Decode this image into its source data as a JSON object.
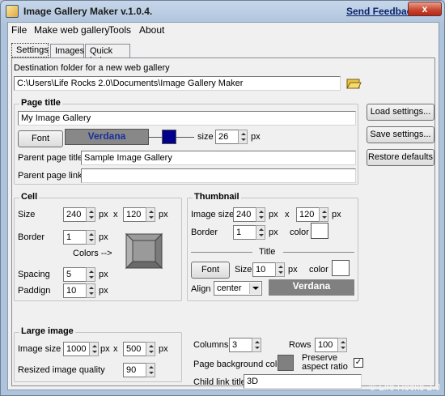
{
  "window": {
    "title": "Image Gallery Maker  v.1.0.4.",
    "feedback": "Send Feedback",
    "close_label": "x"
  },
  "menu": [
    "File",
    "Make web gallery",
    "Tools",
    "About"
  ],
  "tabs": [
    "Settings",
    "Images",
    "Quick help"
  ],
  "destination": {
    "label": "Destination folder for a new web gallery",
    "value": "C:\\Users\\Life Rocks 2.0\\Documents\\Image Gallery Maker"
  },
  "page_title": {
    "group": "Page title",
    "value": "My Image Gallery",
    "font_button": "Font",
    "font_preview": "Verdana",
    "color": "#00008b",
    "size_label": "size",
    "size_value": "26",
    "size_unit": "px",
    "parent_title_label": "Parent page title",
    "parent_title_value": "Sample Image Gallery",
    "parent_link_label": "Parent page link",
    "parent_link_value": ""
  },
  "side_buttons": {
    "load": "Load settings...",
    "save": "Save settings...",
    "restore": "Restore defaults"
  },
  "cell": {
    "group": "Cell",
    "size_label": "Size",
    "width": "240",
    "height": "120",
    "px": "px",
    "x": "x",
    "border_label": "Border",
    "border": "1",
    "colors_label": "Colors -->",
    "spacing_label": "Spacing",
    "spacing": "5",
    "padding_label": "Paddign",
    "padding": "10"
  },
  "thumbnail": {
    "group": "Thumbnail",
    "size_label": "Image size",
    "width": "240",
    "height": "120",
    "px": "px",
    "x": "x",
    "border_label": "Border",
    "border": "1",
    "color_label": "color",
    "title_label": "Title",
    "font_button": "Font",
    "size_label2": "Size",
    "size": "10",
    "color_label2": "color",
    "align_label": "Align",
    "align": "center",
    "font_preview": "Verdana"
  },
  "large_image": {
    "group": "Large image",
    "size_label": "Image size",
    "width": "1000",
    "height": "500",
    "px": "px",
    "x": "x",
    "quality_label": "Resized image quality",
    "quality": "90"
  },
  "columns": {
    "label": "Columns",
    "value": "3"
  },
  "rows": {
    "label": "Rows",
    "value": "100"
  },
  "background": {
    "label": "Page background color",
    "preserve_label": "Preserve aspect ratio",
    "preserve_checked": "✓"
  },
  "child_link": {
    "label": "Child link title",
    "value": "3D"
  },
  "watermark": "© Life Rocks 2.0"
}
